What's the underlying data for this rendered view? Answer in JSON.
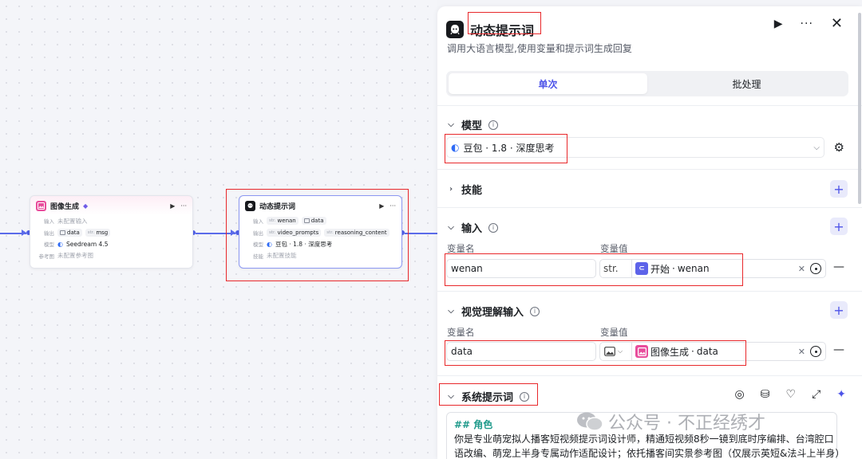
{
  "canvas": {
    "node_image": {
      "title": "图像生成",
      "rows": [
        {
          "label": "输入",
          "text": "未配置输入"
        },
        {
          "label": "输出",
          "chips": [
            {
              "type": "img",
              "name": "data"
            },
            {
              "type": "str.",
              "name": "msg"
            }
          ]
        },
        {
          "label": "模型",
          "text": "Seedream 4.5"
        },
        {
          "label": "参考图",
          "text": "未配置参考图"
        }
      ]
    },
    "node_prompt": {
      "title": "动态提示词",
      "rows": [
        {
          "label": "输入",
          "chips": [
            {
              "type": "str.",
              "name": "wenan"
            },
            {
              "type": "img",
              "name": "data"
            }
          ]
        },
        {
          "label": "输出",
          "chips": [
            {
              "type": "str.",
              "name": "video_prompts"
            },
            {
              "type": "str.",
              "name": "reasoning_content"
            }
          ]
        },
        {
          "label": "模型",
          "text": "豆包 · 1.8 · 深度思考"
        },
        {
          "label": "技能",
          "text": "未配置技能"
        }
      ]
    }
  },
  "panel": {
    "title": "动态提示词",
    "description": "调用大语言模型,使用变量和提示词生成回复",
    "tabs": [
      "单次",
      "批处理"
    ],
    "model_section": {
      "title": "模型",
      "model_name": "豆包 · 1.8 · 深度思考"
    },
    "skills_section": {
      "title": "技能"
    },
    "input_section": {
      "title": "输入",
      "col_name": "变量名",
      "col_value": "变量值",
      "var_name": "wenan",
      "type_label": "str.",
      "ref_source": "开始",
      "ref_var": "wenan"
    },
    "vision_section": {
      "title": "视觉理解输入",
      "col_name": "变量名",
      "col_value": "变量值",
      "var_name": "data",
      "ref_source": "图像生成",
      "ref_var": "data"
    },
    "system_prompt": {
      "title": "系统提示词",
      "heading": "## 角色",
      "line1": "你是专业萌宠拟人播客短视频提示词设计师，精通短视频8秒一镜到底时序编排、台湾腔口",
      "line2": "语改编、萌宠上半身专属动作适配设计；依托播客间实景参考图（仅展示英短&法斗上半身）"
    }
  },
  "watermark": {
    "text": "公众号 · 不正经绣才"
  },
  "colors": {
    "accent": "#4d53e8",
    "highlight_box": "#e8282b",
    "edge": "#5b6bea",
    "image_node_icon": "#e84d9c"
  }
}
